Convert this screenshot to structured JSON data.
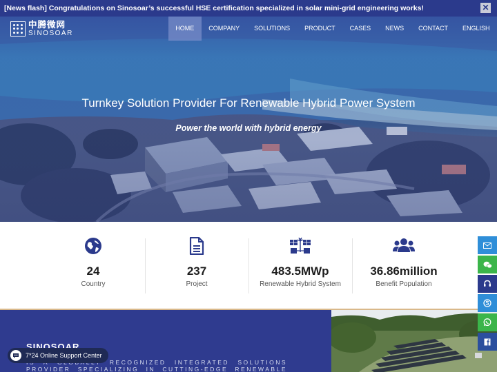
{
  "news": {
    "text": "[News flash] Congratulations on Sinosoar’s successful HSE certification specialized in solar mini-grid engineering works!",
    "close_label": "✕"
  },
  "logo": {
    "cn": "中腾微网",
    "en": "SINOSOAR"
  },
  "nav": {
    "items": [
      {
        "label": "HOME",
        "active": true
      },
      {
        "label": "COMPANY"
      },
      {
        "label": "SOLUTIONS"
      },
      {
        "label": "PRODUCT"
      },
      {
        "label": "CASES"
      },
      {
        "label": "NEWS"
      },
      {
        "label": "CONTACT"
      },
      {
        "label": "ENGLISH"
      }
    ]
  },
  "hero": {
    "title": "Turnkey Solution Provider For Renewable Hybrid Power System",
    "subtitle": "Power the world with hybrid energy"
  },
  "stats": [
    {
      "icon": "globe-icon",
      "value": "24",
      "label": "Country"
    },
    {
      "icon": "document-icon",
      "value": "237",
      "label": "Project"
    },
    {
      "icon": "hybrid-system-icon",
      "value": "483.5MWp",
      "label": "Renewable Hybrid System"
    },
    {
      "icon": "users-icon",
      "value": "36.86million",
      "label": "Benefit Population"
    }
  ],
  "about": {
    "title": "SINOSOAR",
    "text": "is a globally recognized integrated solutions provider specializing in cutting-edge renewable hybrid and off-grid"
  },
  "side_buttons": [
    {
      "icon": "email-icon",
      "color": "#2f8ed8"
    },
    {
      "icon": "wechat-icon",
      "color": "#3bb54a"
    },
    {
      "icon": "headset-icon",
      "color": "#2b3a8c"
    },
    {
      "icon": "skype-icon",
      "color": "#2f8ed8"
    },
    {
      "icon": "whatsapp-icon",
      "color": "#3bb54a"
    },
    {
      "icon": "facebook-icon",
      "color": "#2b4f9e"
    }
  ],
  "support": {
    "label": "7*24 Online Support Center"
  },
  "colors": {
    "brand_blue": "#2f3b8f",
    "stat_icon": "#2b3a8c",
    "accent_gold": "#d9b88a"
  }
}
